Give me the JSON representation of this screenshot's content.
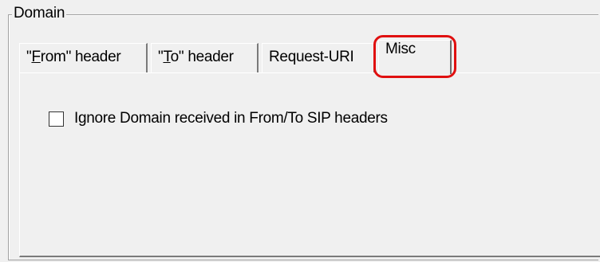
{
  "groupbox": {
    "title": "Domain"
  },
  "tabs": [
    {
      "label_pre": "\"",
      "label_key": "F",
      "label_post": "rom\" header",
      "active": false
    },
    {
      "label_pre": "\"",
      "label_key": "T",
      "label_post": "o\" header",
      "active": false
    },
    {
      "label": "Request-URI",
      "active": false
    },
    {
      "label": "Misc",
      "active": true
    }
  ],
  "misc_panel": {
    "ignore_domain_checkbox": {
      "label": "Ignore Domain received in From/To SIP headers",
      "checked": false
    }
  },
  "colors": {
    "highlight": "#e01010",
    "background": "#f0f0f0"
  }
}
